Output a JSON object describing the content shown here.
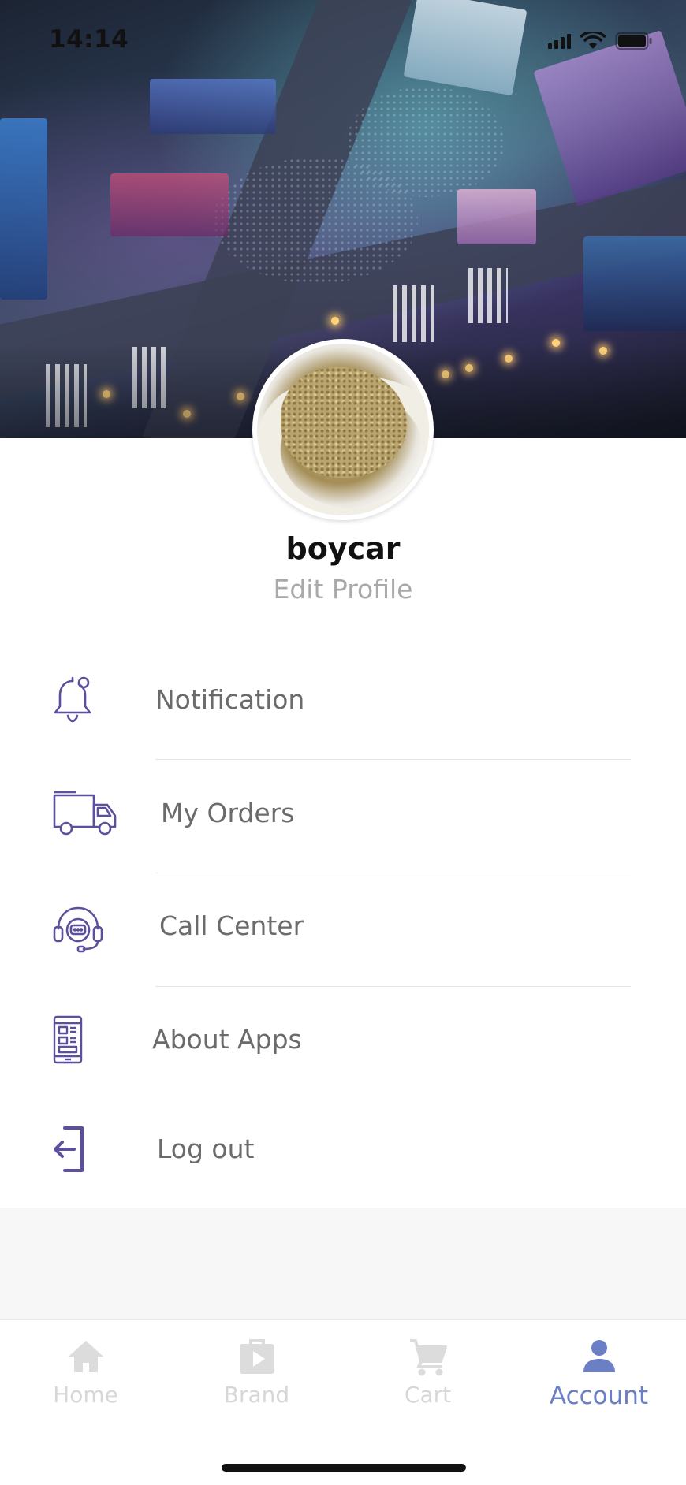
{
  "status_bar": {
    "time": "14:14",
    "icons": [
      "cellular-signal-icon",
      "wifi-icon",
      "battery-icon"
    ]
  },
  "cover_image": "city-intersection-night-aerial-photo",
  "profile": {
    "avatar": "food-plate-photo",
    "username": "boycar",
    "edit_label": "Edit Profile"
  },
  "menu": {
    "items": [
      {
        "label": "Notification",
        "icon": "bell-icon"
      },
      {
        "label": "My Orders",
        "icon": "delivery-truck-icon"
      },
      {
        "label": "Call Center",
        "icon": "headset-support-icon"
      },
      {
        "label": "About Apps",
        "icon": "mobile-app-icon"
      },
      {
        "label": "Log out",
        "icon": "logout-icon"
      }
    ]
  },
  "tab_bar": {
    "tabs": [
      {
        "label": "Home",
        "icon": "home-icon",
        "active": false
      },
      {
        "label": "Brand",
        "icon": "brand-bag-icon",
        "active": false
      },
      {
        "label": "Cart",
        "icon": "cart-icon",
        "active": false
      },
      {
        "label": "Account",
        "icon": "person-icon",
        "active": true
      }
    ]
  },
  "colors": {
    "accent": "#6b7fc4",
    "icon_purple": "#5c4f9c",
    "menu_text": "#6b6b6b",
    "inactive_tab": "#d7d7d7"
  }
}
